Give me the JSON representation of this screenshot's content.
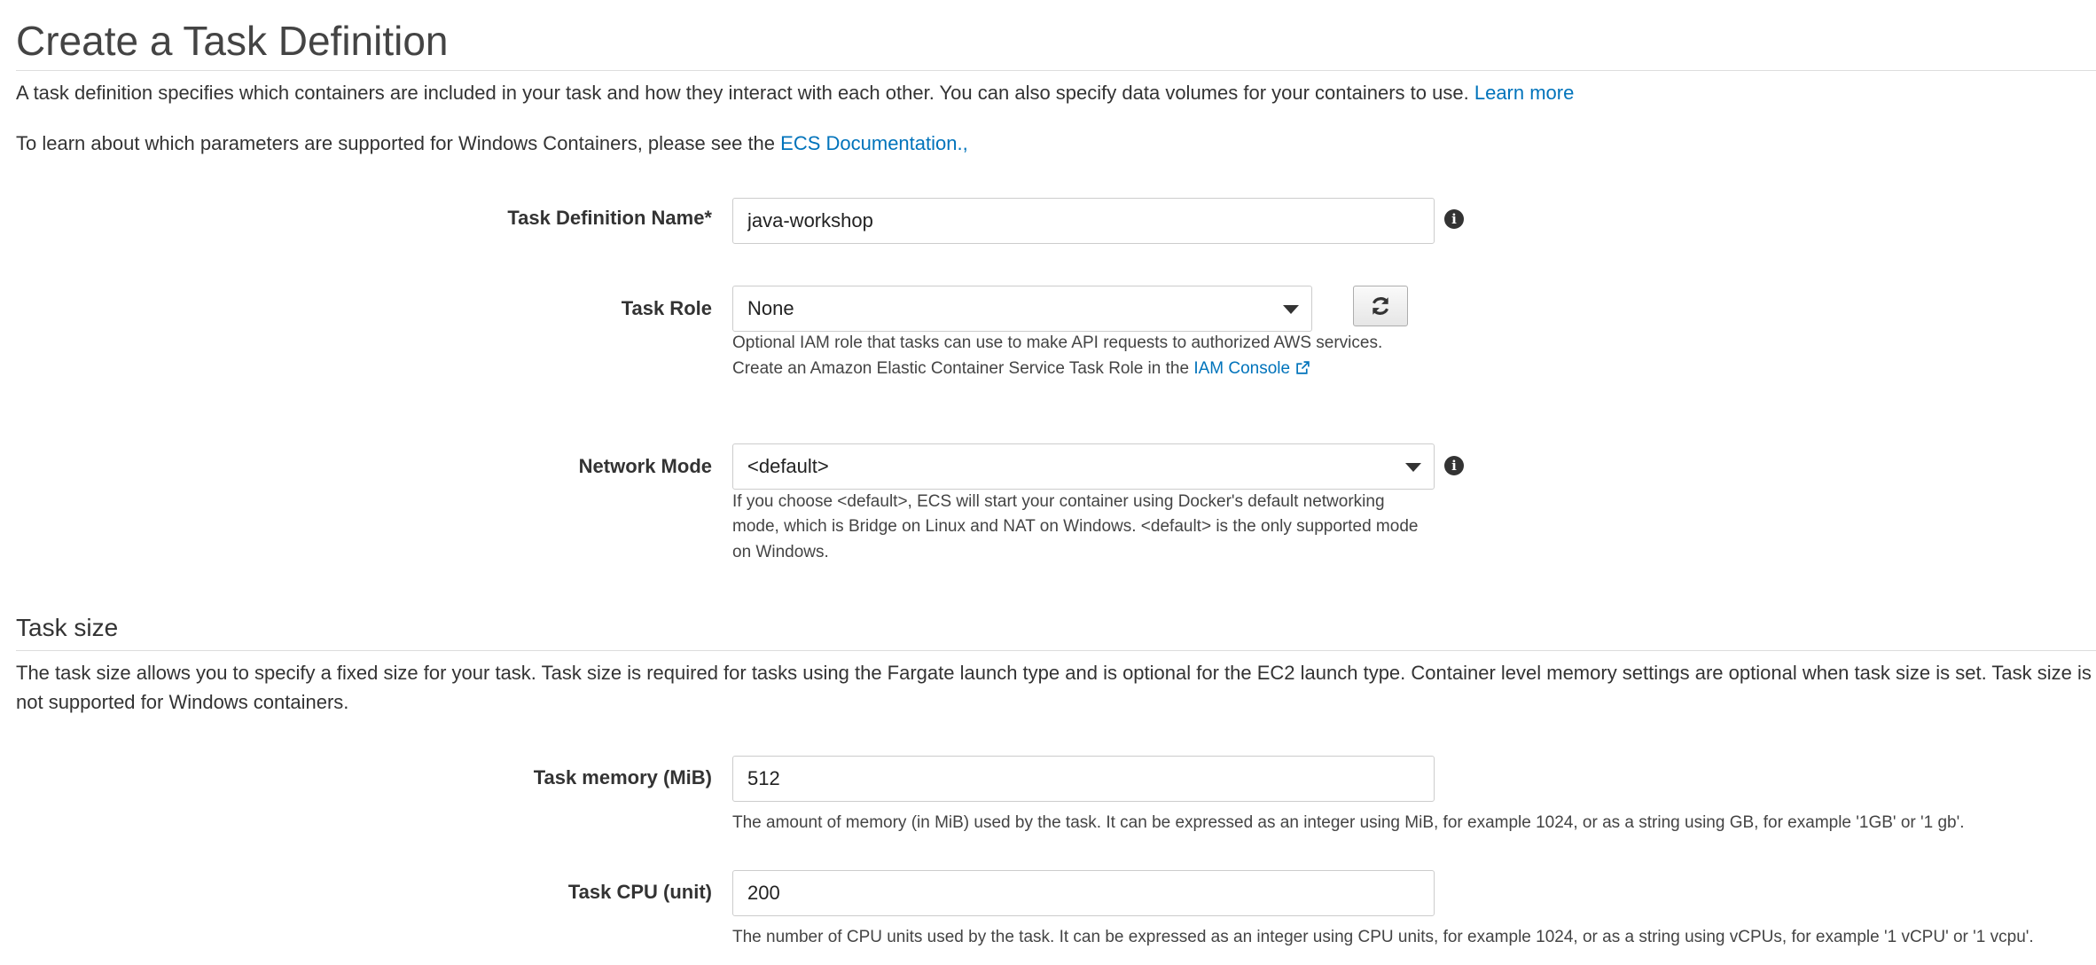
{
  "page": {
    "title": "Create a Task Definition",
    "intro": "A task definition specifies which containers are included in your task and how they interact with each other. You can also specify data volumes for your containers to use.",
    "learn_more": "Learn more",
    "windows_note": "To learn about which parameters are supported for Windows Containers, please see the",
    "ecs_docs_link": "ECS Documentation.,"
  },
  "form": {
    "task_definition_name": {
      "label": "Task Definition Name*",
      "value": "java-workshop",
      "icon": "info-icon"
    },
    "task_role": {
      "label": "Task Role",
      "value": "None",
      "refresh_icon": "refresh-icon",
      "help_line1": "Optional IAM role that tasks can use to make API requests to authorized AWS services.",
      "help_line2": "Create an Amazon Elastic Container Service Task Role in the",
      "iam_console_link": "IAM Console",
      "external_icon": "external-link-icon"
    },
    "network_mode": {
      "label": "Network Mode",
      "value": "<default>",
      "icon": "info-icon",
      "help_line1": "If you choose <default>, ECS will start your container using Docker's default networking",
      "help_line2": "mode, which is Bridge on Linux and NAT on Windows. <default> is the only supported mode",
      "help_line3": "on Windows."
    }
  },
  "task_size": {
    "title": "Task size",
    "description": "The task size allows you to specify a fixed size for your task. Task size is required for tasks using the Fargate launch type and is optional for the EC2 launch type. Container level memory settings are optional when task size is set. Task size is not supported for Windows containers.",
    "memory": {
      "label": "Task memory (MiB)",
      "value": "512",
      "help": "The amount of memory (in MiB) used by the task. It can be expressed as an integer using MiB, for example 1024, or as a string using GB, for example '1GB' or '1 gb'."
    },
    "cpu": {
      "label": "Task CPU (unit)",
      "value": "200",
      "help": "The number of CPU units used by the task. It can be expressed as an integer using CPU units, for example 1024, or as a string using vCPUs, for example '1 vCPU' or '1 vcpu'."
    }
  },
  "colors": {
    "link": "#0073bb",
    "text": "#333333",
    "border": "#cccccc"
  }
}
